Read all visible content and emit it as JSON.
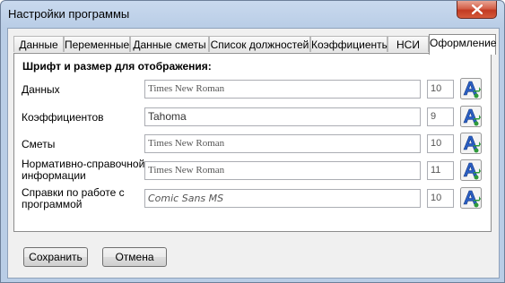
{
  "window": {
    "title": "Настройки программы"
  },
  "tabs": [
    {
      "label": "Данные"
    },
    {
      "label": "Переменные"
    },
    {
      "label": "Данные сметы"
    },
    {
      "label": "Список должностей"
    },
    {
      "label": "Коэффициенты"
    },
    {
      "label": "НСИ"
    },
    {
      "label": "Оформление",
      "active": true
    }
  ],
  "panel": {
    "heading": "Шрифт и размер для отображения:",
    "rows": [
      {
        "label": "Данных",
        "font": "Times New Roman",
        "size": "10"
      },
      {
        "label": "Коэффициентов",
        "font": "Tahoma",
        "size": "9"
      },
      {
        "label": "Сметы",
        "font": "Times New Roman",
        "size": "10"
      },
      {
        "label_line1": "Нормативно-справочной",
        "label_line2": "информации",
        "font": "Times New Roman",
        "size": "11"
      },
      {
        "label_line1": "Справки по работе с",
        "label_line2": "программой",
        "font": "Comic Sans MS",
        "size": "10"
      }
    ]
  },
  "buttons": {
    "save_label": "Сохранить",
    "cancel_label": "Отмена"
  },
  "icons": {
    "font_picker": "font-picker-icon",
    "close": "close-icon"
  },
  "colors": {
    "close_button": "#c9462c",
    "icon_blue": "#2a5fc4",
    "icon_green": "#2e9a3a"
  }
}
